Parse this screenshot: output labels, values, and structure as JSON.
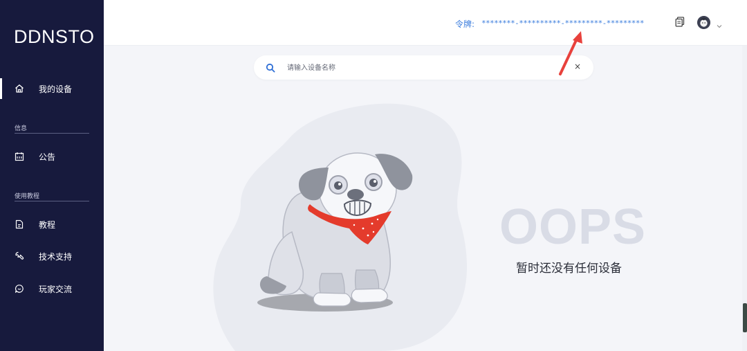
{
  "app": {
    "logo": "DDNSTO"
  },
  "sidebar": {
    "items": [
      {
        "label": "我的设备",
        "icon": "home-icon",
        "active": true
      },
      {
        "label": "公告",
        "icon": "calendar-icon"
      },
      {
        "label": "教程",
        "icon": "document-icon"
      },
      {
        "label": "技术支持",
        "icon": "wrench-icon"
      },
      {
        "label": "玩家交流",
        "icon": "chat-icon"
      }
    ],
    "sections": [
      {
        "label": "信息"
      },
      {
        "label": "使用教程"
      }
    ]
  },
  "header": {
    "token_label": "令牌:",
    "token_value": "********-**********-*********-*********",
    "copy_icon": "copy-icon",
    "avatar_icon": "user-avatar",
    "menu_icon": "chevron-down-icon"
  },
  "search": {
    "placeholder": "请输入设备名称",
    "value": "",
    "clear_label": "×"
  },
  "empty_state": {
    "title": "OOPS",
    "message": "暂时还没有任何设备"
  },
  "colors": {
    "sidebar_bg": "#171a3d",
    "accent": "#3b7ddd",
    "arrow": "#e8413c",
    "scarf": "#e43b2c"
  }
}
